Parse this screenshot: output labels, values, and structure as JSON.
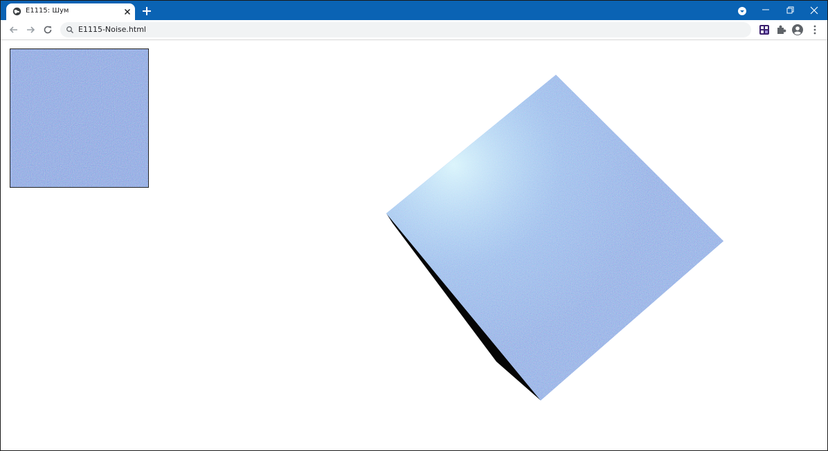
{
  "browser": {
    "tab_title": "E1115: Шум",
    "url": "E1115-Noise.html"
  },
  "icons": {
    "tab_favicon": "globe-icon",
    "tab_close": "close-icon",
    "new_tab": "plus-icon",
    "profile_menu": "chevron-down-circle-icon",
    "minimize": "minimize-icon",
    "restore": "restore-icon",
    "close_window": "close-icon",
    "back": "arrow-left-icon",
    "forward": "arrow-right-icon",
    "reload": "reload-icon",
    "search": "search-icon",
    "extension_app": "app-extension-icon",
    "extensions": "puzzle-icon",
    "profile": "account-circle-icon",
    "menu": "more-vertical-icon"
  },
  "colors": {
    "titlebar": "#0a63b4",
    "noise_base": "#5b86e0",
    "cube_top": "#6f9ae8",
    "cube_side": "#050505"
  }
}
